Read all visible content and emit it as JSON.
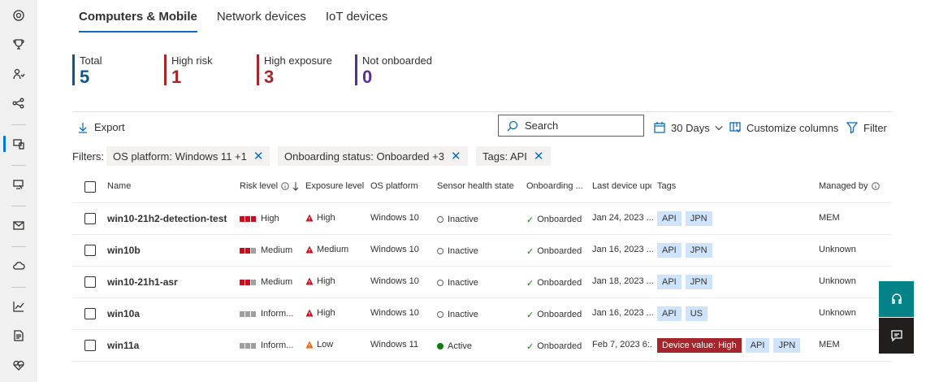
{
  "tabs": [
    {
      "label": "Computers & Mobile",
      "active": true
    },
    {
      "label": "Network devices",
      "active": false
    },
    {
      "label": "IoT devices",
      "active": false
    }
  ],
  "summary": [
    {
      "label": "Total",
      "value": "5",
      "color": "#0f548c"
    },
    {
      "label": "High risk",
      "value": "1",
      "color": "#a4262c"
    },
    {
      "label": "High exposure",
      "value": "3",
      "color": "#a4262c"
    },
    {
      "label": "Not onboarded",
      "value": "0",
      "color": "#5c2e91"
    }
  ],
  "toolbar": {
    "export_label": "Export",
    "search_placeholder": "Search",
    "days_label": "30 Days",
    "customize_label": "Customize columns",
    "filter_label": "Filter"
  },
  "filters": {
    "label": "Filters:",
    "chips": [
      "OS platform: Windows 11 +1",
      "Onboarding status: Onboarded +3",
      "Tags: API"
    ]
  },
  "columns": [
    "Name",
    "Risk level",
    "Exposure level",
    "OS platform",
    "Sensor health state",
    "Onboarding ...",
    "Last device upc",
    "Tags",
    "Managed by"
  ],
  "rows": [
    {
      "name": "win10-21h2-detection-test",
      "risk": "High",
      "risk_level": 3,
      "exposure": "High",
      "exposure_color": "#c50f1f",
      "os": "Windows 10",
      "sensor": "Inactive",
      "sensor_active": false,
      "onboarding": "Onboarded",
      "last_update": "Jan 24, 2023 ...",
      "tags": [
        "API",
        "JPN"
      ],
      "device_value": "",
      "managed_by": "MEM"
    },
    {
      "name": "win10b",
      "risk": "Medium",
      "risk_level": 2,
      "exposure": "Medium",
      "exposure_color": "#c50f1f",
      "os": "Windows 10",
      "sensor": "Inactive",
      "sensor_active": false,
      "onboarding": "Onboarded",
      "last_update": "Jan 16, 2023 ...",
      "tags": [
        "API",
        "JPN"
      ],
      "device_value": "",
      "managed_by": "Unknown"
    },
    {
      "name": "win10-21h1-asr",
      "risk": "Medium",
      "risk_level": 2,
      "exposure": "High",
      "exposure_color": "#c50f1f",
      "os": "Windows 10",
      "sensor": "Inactive",
      "sensor_active": false,
      "onboarding": "Onboarded",
      "last_update": "Jan 18, 2023 ...",
      "tags": [
        "API",
        "JPN"
      ],
      "device_value": "",
      "managed_by": "Unknown"
    },
    {
      "name": "win10a",
      "risk": "Inform...",
      "risk_level": 0,
      "exposure": "High",
      "exposure_color": "#c50f1f",
      "os": "Windows 10",
      "sensor": "Inactive",
      "sensor_active": false,
      "onboarding": "Onboarded",
      "last_update": "Jan 16, 2023 ...",
      "tags": [
        "API",
        "US"
      ],
      "device_value": "",
      "managed_by": "Unknown"
    },
    {
      "name": "win11a",
      "risk": "Inform...",
      "risk_level": 0,
      "exposure": "Low",
      "exposure_color": "#f7630c",
      "os": "Windows 11",
      "sensor": "Active",
      "sensor_active": true,
      "onboarding": "Onboarded",
      "last_update": "Feb 7, 2023 6:...",
      "tags": [
        "API",
        "JPN"
      ],
      "device_value": "Device value: High",
      "managed_by": "MEM"
    }
  ],
  "colors": {
    "accent": "#0f6cbd",
    "teal_fab": "#038387",
    "dark_fab": "#201f1e"
  }
}
